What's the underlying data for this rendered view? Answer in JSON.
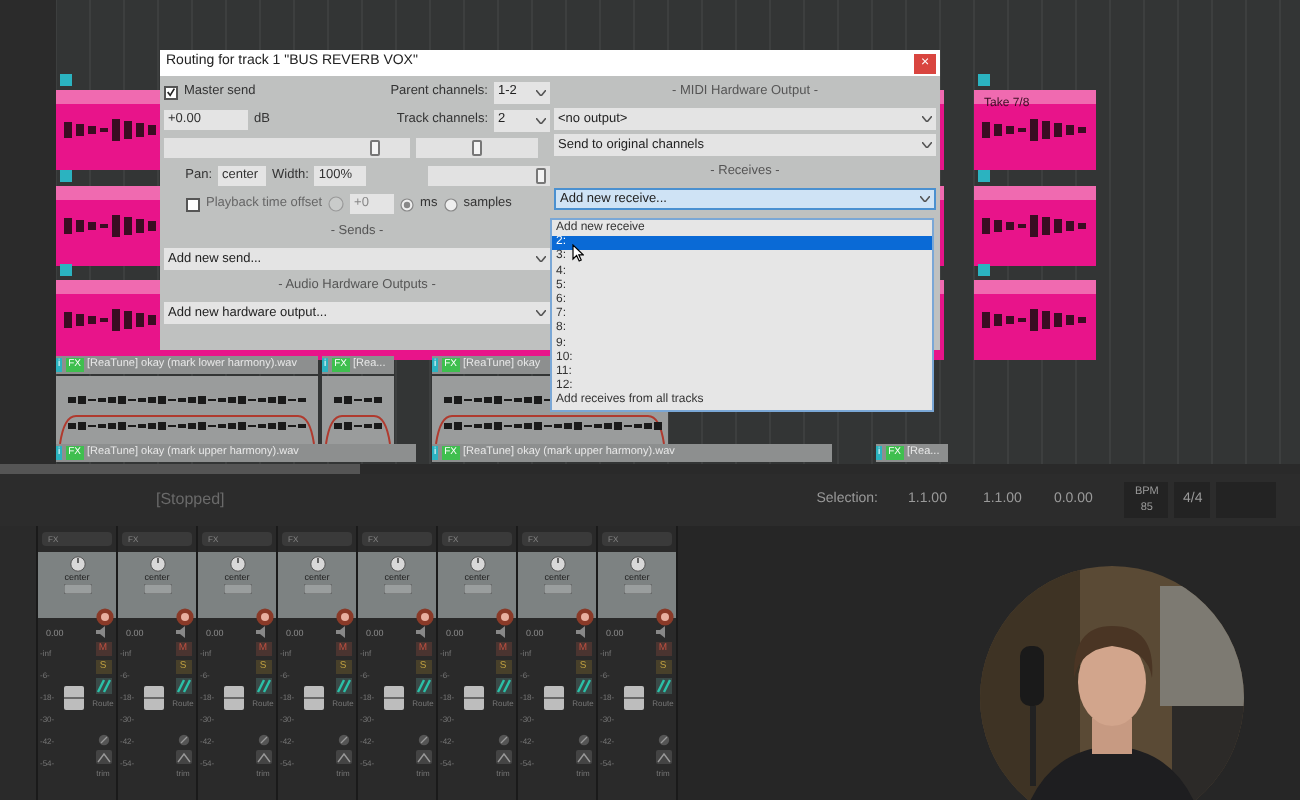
{
  "dialog": {
    "title": "Routing for track 1 \"BUS REVERB VOX\"",
    "close": "×",
    "master_send": {
      "label": "Master send",
      "checked": true
    },
    "parent_channels": {
      "label": "Parent channels:",
      "value": "1-2"
    },
    "volume": {
      "value": "+0.00",
      "unit": "dB",
      "level": 0.87
    },
    "track_channels": {
      "label": "Track channels:",
      "value": "2"
    },
    "pan_slider": {
      "level": 0.5
    },
    "pan": {
      "label": "Pan:",
      "value": "center"
    },
    "width": {
      "label": "Width:",
      "value": "100%",
      "level": 0.97
    },
    "playback_offset": {
      "label": "Playback time offset",
      "checked": false,
      "value": "+0"
    },
    "units": [
      {
        "label": "ms",
        "selected": true
      },
      {
        "label": "samples",
        "selected": false
      }
    ],
    "sends": {
      "heading": "- Sends -",
      "value": "Add new send..."
    },
    "hw_outputs": {
      "heading": "- Audio Hardware Outputs -",
      "value": "Add new hardware output..."
    },
    "midi": {
      "heading": "- MIDI Hardware Output -",
      "output": "<no output>",
      "channels": "Send to original channels"
    },
    "receives": {
      "heading": "- Receives -",
      "value": "Add new receive...",
      "options": [
        {
          "label": "Add new receive",
          "selected": false
        },
        {
          "label": "2:",
          "selected": true
        },
        {
          "label": "3:",
          "selected": false
        },
        {
          "label": "4:",
          "selected": false
        },
        {
          "label": "5:",
          "selected": false
        },
        {
          "label": "6:",
          "selected": false
        },
        {
          "label": "7:",
          "selected": false
        },
        {
          "label": "8:",
          "selected": false
        },
        {
          "label": "9:",
          "selected": false
        },
        {
          "label": "10:",
          "selected": false
        },
        {
          "label": "11:",
          "selected": false
        },
        {
          "label": "12:",
          "selected": false
        },
        {
          "label": "Add receives from all tracks",
          "selected": false
        }
      ]
    }
  },
  "take_label": "Take 7/8",
  "lanes": [
    {
      "items": [
        {
          "badges": [
            "i",
            "FX"
          ],
          "label": "[ReaTune] okay (mark lower harmony).wav"
        },
        {
          "badges": [
            "i",
            "FX"
          ],
          "label": "[Rea..."
        },
        {
          "badges": [
            "i",
            "FX"
          ],
          "label": "[ReaTune] okay"
        }
      ]
    },
    {
      "items": [
        {
          "badges": [
            "i",
            "FX"
          ],
          "label": "[ReaTune] okay (mark upper harmony).wav"
        },
        {
          "badges": [
            "i",
            "FX"
          ],
          "label": "[ReaTune] okay (mark upper harmony).wav"
        },
        {
          "badges": [
            "i",
            "FX"
          ],
          "label": "[Rea..."
        }
      ]
    }
  ],
  "transport": {
    "state": "[Stopped]",
    "selection_label": "Selection:",
    "start": "1.1.00",
    "end": "1.1.00",
    "length": "0.0.00",
    "bpm_label": "BPM",
    "bpm": "85",
    "signature": "4/4"
  },
  "strips": [
    {
      "fx": "FX",
      "pan": "center",
      "volume": "0.00",
      "mute": "M",
      "solo": "S",
      "route": "Route",
      "trim": "trim",
      "scale": [
        "-inf",
        "-6-",
        "-18-",
        "-30-",
        "-42-",
        "-54-"
      ]
    },
    {
      "fx": "FX",
      "pan": "center",
      "volume": "0.00",
      "mute": "M",
      "solo": "S",
      "route": "Route",
      "trim": "trim",
      "scale": [
        "-inf",
        "-6-",
        "-18-",
        "-30-",
        "-42-",
        "-54-"
      ]
    },
    {
      "fx": "FX",
      "pan": "center",
      "volume": "0.00",
      "mute": "M",
      "solo": "S",
      "route": "Route",
      "trim": "trim",
      "scale": [
        "-inf",
        "-6-",
        "-18-",
        "-30-",
        "-42-",
        "-54-"
      ]
    },
    {
      "fx": "FX",
      "pan": "center",
      "volume": "0.00",
      "mute": "M",
      "solo": "S",
      "route": "Route",
      "trim": "trim",
      "scale": [
        "-inf",
        "-6-",
        "-18-",
        "-30-",
        "-42-",
        "-54-"
      ]
    },
    {
      "fx": "FX",
      "pan": "center",
      "volume": "0.00",
      "mute": "M",
      "solo": "S",
      "route": "Route",
      "trim": "trim",
      "scale": [
        "-inf",
        "-6-",
        "-18-",
        "-30-",
        "-42-",
        "-54-"
      ]
    },
    {
      "fx": "FX",
      "pan": "center",
      "volume": "0.00",
      "mute": "M",
      "solo": "S",
      "route": "Route",
      "trim": "trim",
      "scale": [
        "-inf",
        "-6-",
        "-18-",
        "-30-",
        "-42-",
        "-54-"
      ]
    },
    {
      "fx": "FX",
      "pan": "center",
      "volume": "0.00",
      "mute": "M",
      "solo": "S",
      "route": "Route",
      "trim": "trim",
      "scale": [
        "-inf",
        "-6-",
        "-18-",
        "-30-",
        "-42-",
        "-54-"
      ]
    },
    {
      "fx": "FX",
      "pan": "center",
      "volume": "0.00",
      "mute": "M",
      "solo": "S",
      "route": "Route",
      "trim": "trim",
      "scale": [
        "-inf",
        "-6-",
        "-18-",
        "-30-",
        "-42-",
        "-54-"
      ]
    }
  ]
}
